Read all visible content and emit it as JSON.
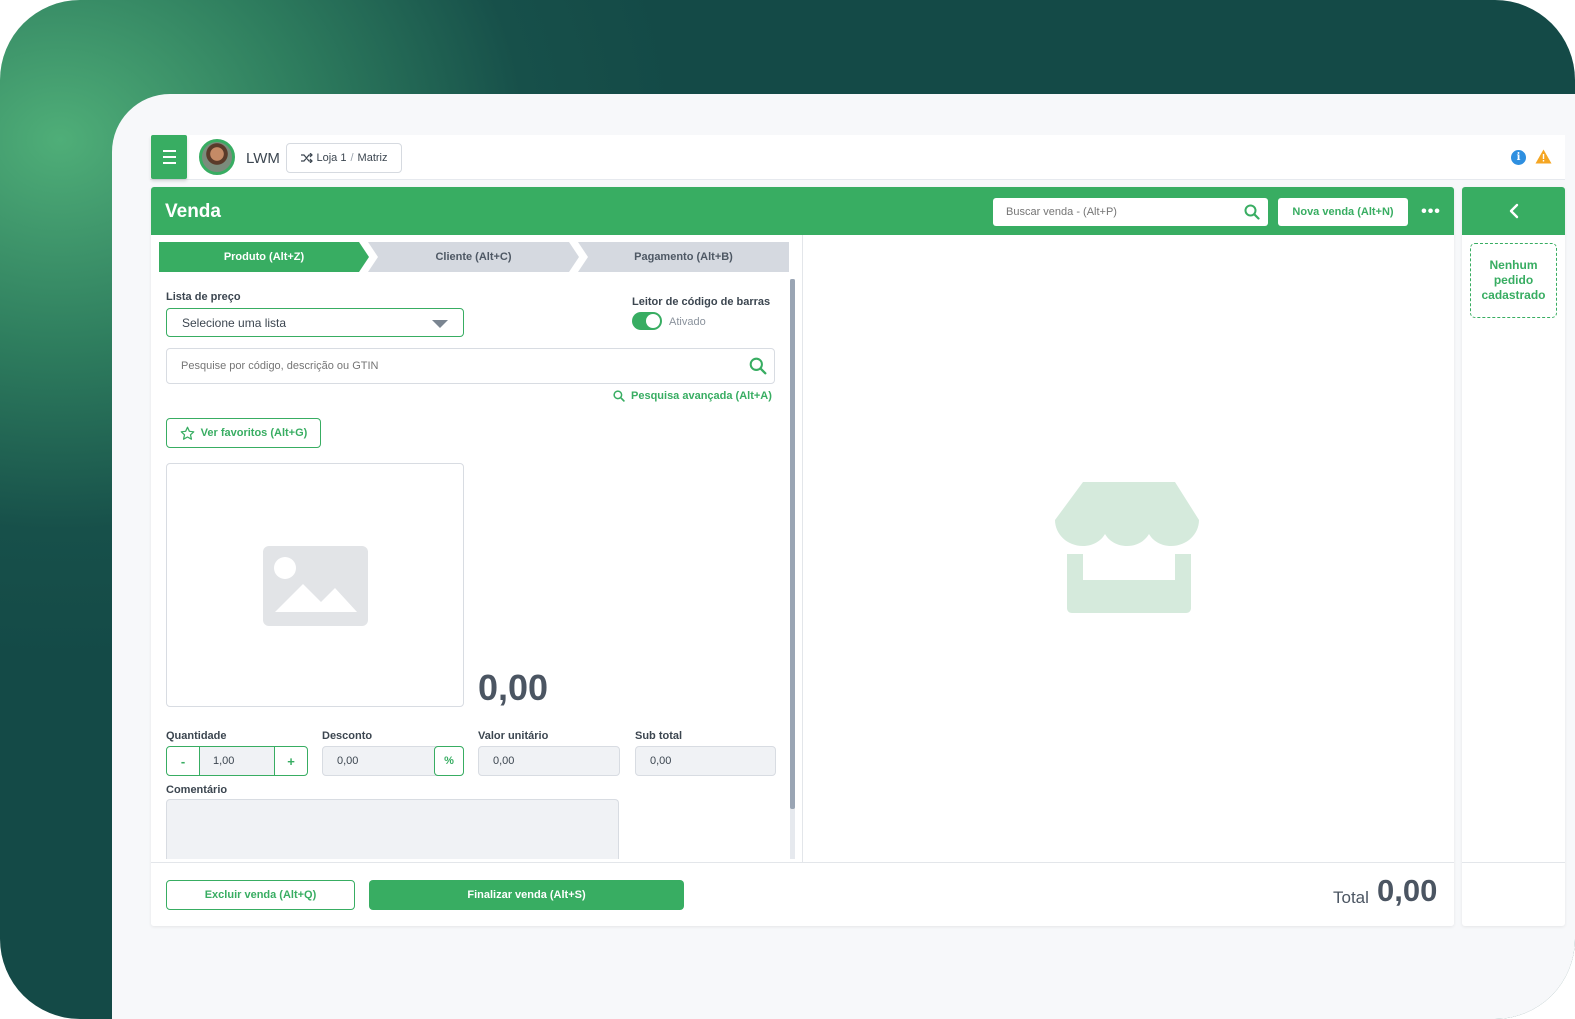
{
  "header": {
    "company": "LWM",
    "store": "Loja 1",
    "store_separator": "/",
    "store_branch": "Matriz"
  },
  "sale": {
    "title": "Venda",
    "search_placeholder": "Buscar venda - (Alt+P)",
    "new_sale_label": "Nova venda  (Alt+N)",
    "more_label": "•••"
  },
  "steps": [
    {
      "label": "Produto (Alt+Z)",
      "active": true
    },
    {
      "label": "Cliente (Alt+C)",
      "active": false
    },
    {
      "label": "Pagamento (Alt+B)",
      "active": false
    }
  ],
  "product": {
    "price_list_label": "Lista de preço",
    "price_list_value": "Selecione uma lista",
    "barcode_label": "Leitor de código de barras",
    "barcode_status": "Ativado",
    "barcode_enabled": true,
    "search_placeholder": "Pesquise por código, descrição ou GTIN",
    "advanced_search": "Pesquisa avançada (Alt+A)",
    "favorites_label": "Ver favoritos (Alt+G)",
    "price": "0,00",
    "quantity_label": "Quantidade",
    "quantity_value": "1,00",
    "qty_minus": "-",
    "qty_plus": "+",
    "discount_label": "Desconto",
    "discount_value": "0,00",
    "discount_unit": "%",
    "unit_value_label": "Valor unitário",
    "unit_value": "0,00",
    "subtotal_label": "Sub total",
    "subtotal_value": "0,00",
    "comment_label": "Comentário"
  },
  "footer": {
    "delete_label": "Excluir venda (Alt+Q)",
    "finish_label": "Finalizar venda (Alt+S)",
    "total_label": "Total",
    "total_value": "0,00"
  },
  "side": {
    "empty_text": "Nenhum pedido cadastrado"
  },
  "colors": {
    "accent": "#38ad62",
    "background_dark": "#144a47",
    "info": "#2e8fe0",
    "warning": "#f5a623",
    "illustration": "#d5eadc"
  },
  "icons": [
    "menu-icon",
    "shuffle-icon",
    "info-icon",
    "warning-icon",
    "search-icon",
    "more-icon",
    "star-icon",
    "image-placeholder-icon",
    "store-icon",
    "chevron-left-icon"
  ]
}
